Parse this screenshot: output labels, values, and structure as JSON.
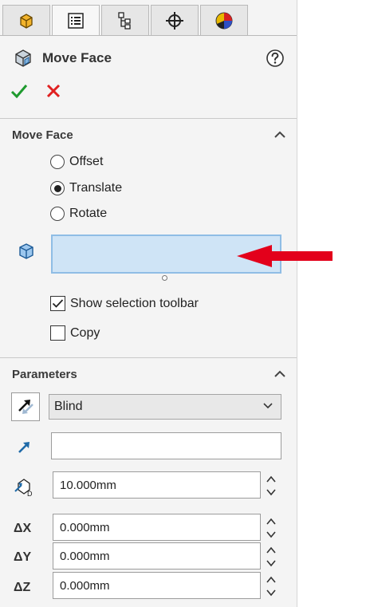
{
  "tabs": [
    {
      "name": "featuremanager",
      "icon": "featuremanager-icon"
    },
    {
      "name": "propertymanager",
      "icon": "propertymanager-icon"
    },
    {
      "name": "configurationmanager",
      "icon": "configurationmanager-icon"
    },
    {
      "name": "dimxpertmanager",
      "icon": "dimxpertmanager-icon"
    },
    {
      "name": "displaymanager",
      "icon": "displaymanager-icon"
    }
  ],
  "header": {
    "title": "Move Face",
    "help_icon": "help-icon"
  },
  "actions": {
    "ok_icon": "check-icon",
    "cancel_icon": "close-icon",
    "ok_color": "#1e9a2e",
    "cancel_color": "#e02020"
  },
  "move_face": {
    "section_title": "Move Face",
    "options": [
      {
        "label": "Offset",
        "selected": false
      },
      {
        "label": "Translate",
        "selected": true
      },
      {
        "label": "Rotate",
        "selected": false
      }
    ],
    "selection_box_value": "",
    "show_selection_toolbar": {
      "label": "Show selection toolbar",
      "checked": true
    },
    "copy": {
      "label": "Copy",
      "checked": false
    }
  },
  "parameters": {
    "section_title": "Parameters",
    "end_condition": "Blind",
    "direction_value": "",
    "distance": "10.000mm",
    "dx_label": "ΔX",
    "dy_label": "ΔY",
    "dz_label": "ΔZ",
    "dx": "0.000mm",
    "dy": "0.000mm",
    "dz": "0.000mm"
  },
  "annotation": {
    "arrow_color": "#e3001b"
  }
}
